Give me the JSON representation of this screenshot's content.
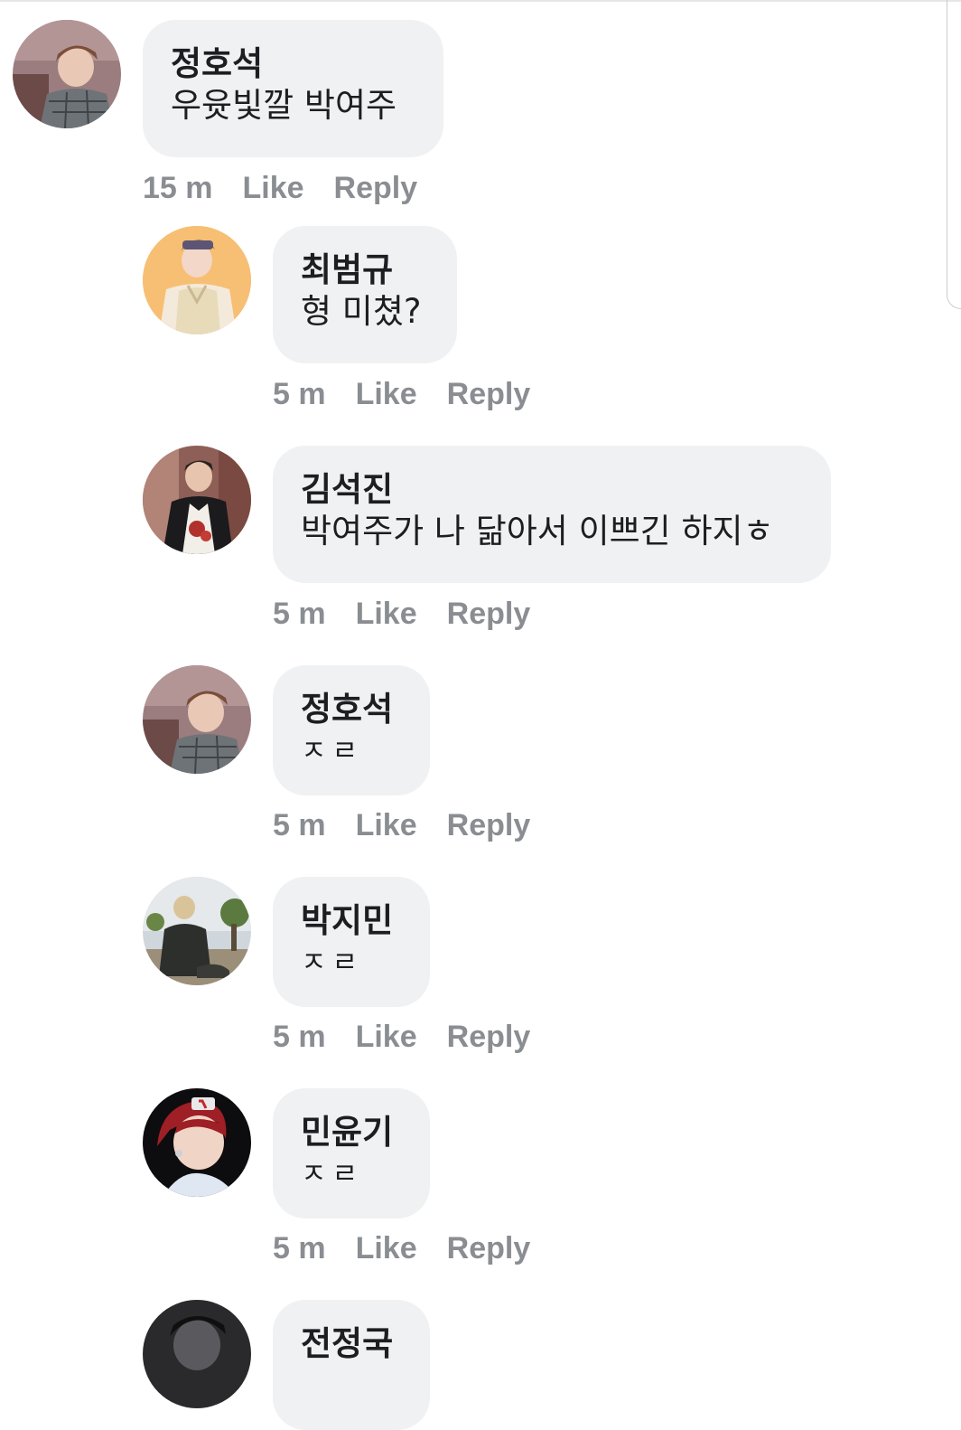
{
  "comments": [
    {
      "name": "정호석",
      "text": "우윳빛깔 박여주",
      "time": "15 m",
      "like": "Like",
      "reply": "Reply",
      "avatar": "hoseok"
    },
    {
      "name": "최범규",
      "text": "형 미쳤?",
      "time": "5 m",
      "like": "Like",
      "reply": "Reply",
      "avatar": "beomgyu"
    },
    {
      "name": "김석진",
      "text": "박여주가 나 닮아서 이쁘긴 하지ㅎ",
      "time": "5 m",
      "like": "Like",
      "reply": "Reply",
      "avatar": "seokjin"
    },
    {
      "name": "정호석",
      "text": "ㅈㄹ",
      "time": "5 m",
      "like": "Like",
      "reply": "Reply",
      "avatar": "hoseok"
    },
    {
      "name": "박지민",
      "text": "ㅈㄹ",
      "time": "5 m",
      "like": "Like",
      "reply": "Reply",
      "avatar": "jimin"
    },
    {
      "name": "민윤기",
      "text": "ㅈㄹ",
      "time": "5 m",
      "like": "Like",
      "reply": "Reply",
      "avatar": "yoongi"
    },
    {
      "name": "전정국",
      "text": "",
      "time": "",
      "like": "",
      "reply": "",
      "avatar": "jungkook"
    }
  ],
  "colors": {
    "bubble": "#f0f1f3",
    "name": "#1c1e21",
    "meta": "#8a8d91"
  }
}
